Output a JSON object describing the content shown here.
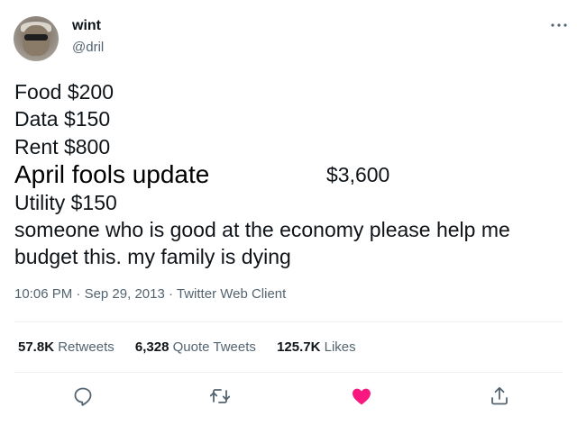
{
  "user": {
    "display_name": "wint",
    "handle": "@dril"
  },
  "tweet": {
    "lines": [
      "Food $200",
      "Data $150",
      "Rent $800",
      "April fools update",
      "$3,600",
      "Utility $150",
      "someone who is good at the economy please help me",
      "budget this. my family is dying"
    ],
    "time": "10:06 PM",
    "date": "Sep 29, 2013",
    "client": "Twitter Web Client",
    "separator": "·"
  },
  "stats": {
    "retweets_count": "57.8K",
    "retweets_label": "Retweets",
    "quotes_count": "6,328",
    "quotes_label": "Quote Tweets",
    "likes_count": "125.7K",
    "likes_label": "Likes"
  },
  "icons": {
    "more": "more-horizontal-icon",
    "reply": "reply-icon",
    "retweet": "retweet-icon",
    "like": "heart-filled-icon",
    "share": "share-icon"
  },
  "colors": {
    "text": "#0f1419",
    "secondary": "#536471",
    "like_active": "#f91880",
    "divider": "#eff3f4"
  }
}
